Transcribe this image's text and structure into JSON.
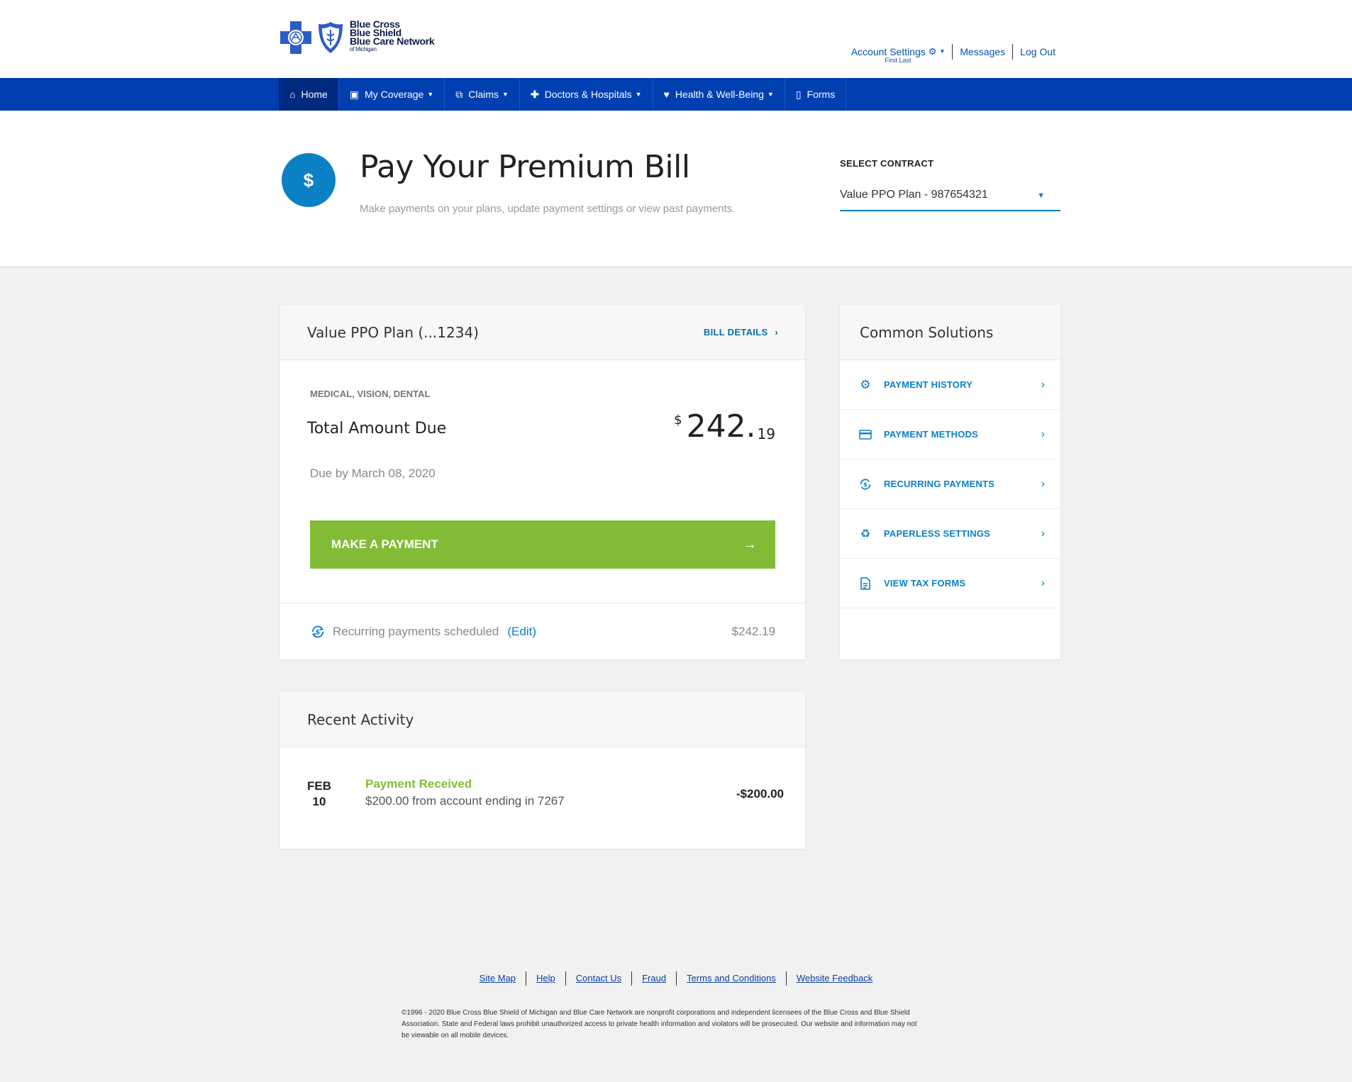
{
  "brand": {
    "logo_line1": "Blue Cross",
    "logo_line2": "Blue Shield",
    "logo_line3": "Blue Care Network",
    "logo_line4": "of Michigan",
    "primary_color": "#003fb0",
    "accent_color": "#0b80c4",
    "action_color": "#82bc36"
  },
  "util_nav": {
    "account_settings": "Account Settings",
    "user_name": "First Last",
    "messages": "Messages",
    "logout": "Log Out"
  },
  "nav": {
    "items": [
      {
        "label": "Home",
        "icon": "home-icon"
      },
      {
        "label": "My Coverage",
        "icon": "document-icon"
      },
      {
        "label": "Claims",
        "icon": "copy-icon"
      },
      {
        "label": "Doctors & Hospitals",
        "icon": "plus-icon"
      },
      {
        "label": "Health & Well-Being",
        "icon": "heart-icon"
      },
      {
        "label": "Forms",
        "icon": "file-icon"
      }
    ]
  },
  "page": {
    "icon_symbol": "$",
    "title": "Pay Your Premium Bill",
    "subtitle": "Make payments on your plans, update payment settings or view past payments."
  },
  "contract": {
    "label": "SELECT CONTRACT",
    "selected": "Value PPO Plan - 987654321"
  },
  "plan_card": {
    "title": "Value PPO Plan (...1234)",
    "bill_details": "BILL DETAILS",
    "coverage": "MEDICAL, VISION, DENTAL",
    "total_label": "Total Amount Due",
    "currency": "$",
    "amount_whole": "242.",
    "amount_cents": "19",
    "due": "Due by March 08, 2020",
    "pay_button": "MAKE A PAYMENT",
    "recurring_label": "Recurring payments scheduled",
    "recurring_edit": "(Edit)",
    "recurring_amount": "$242.19"
  },
  "solutions": {
    "title": "Common Solutions",
    "items": [
      {
        "label": "PAYMENT HISTORY",
        "icon": "gear-icon"
      },
      {
        "label": "PAYMENT METHODS",
        "icon": "credit-card-icon"
      },
      {
        "label": "RECURRING PAYMENTS",
        "icon": "recurring-dollar-icon"
      },
      {
        "label": "PAPERLESS SETTINGS",
        "icon": "recycle-icon"
      },
      {
        "label": "VIEW TAX FORMS",
        "icon": "document-icon"
      }
    ]
  },
  "activity": {
    "title": "Recent Activity",
    "items": [
      {
        "month": "FEB",
        "day": "10",
        "title": "Payment Received",
        "desc": "$200.00 from account ending in 7267",
        "amount": "-$200.00"
      }
    ]
  },
  "footer": {
    "links": [
      "Site Map",
      "Help",
      "Contact Us",
      "Fraud",
      "Terms and Conditions",
      "Website Feedback"
    ],
    "legal": "©1996 - 2020 Blue Cross Blue Shield of Michigan and Blue Care Network are nonprofit corporations and independent licensees of the Blue Cross and Blue Shield Association. State and Federal laws prohibit unauthorized access to private health information and violators will be prosecuted. Our website and information may not be viewable on all mobile devices."
  }
}
